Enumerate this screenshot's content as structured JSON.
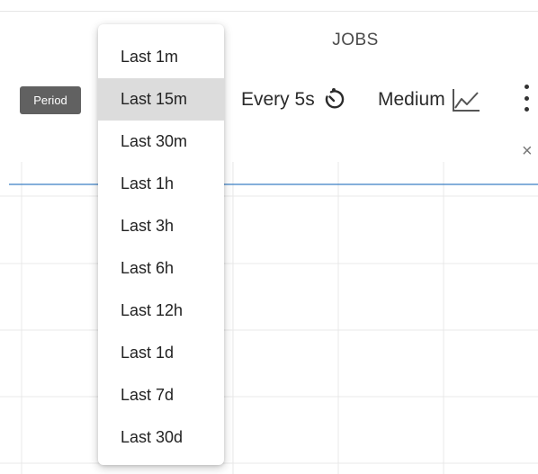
{
  "header": {
    "title": "JOBS"
  },
  "toolbar": {
    "period_label": "Period",
    "refresh_label": "Every 5s",
    "refresh_icon": "timer-icon",
    "resolution_label": "Medium",
    "resolution_icon": "line-chart-icon",
    "more_icon": "kebab-menu-icon",
    "close_icon": "close-icon",
    "close_glyph": "×"
  },
  "period_menu": {
    "selected": "Last 15m",
    "items": [
      {
        "label": "Last 1m"
      },
      {
        "label": "Last 15m"
      },
      {
        "label": "Last 30m"
      },
      {
        "label": "Last 1h"
      },
      {
        "label": "Last 3h"
      },
      {
        "label": "Last 6h"
      },
      {
        "label": "Last 12h"
      },
      {
        "label": "Last 1d"
      },
      {
        "label": "Last 7d"
      },
      {
        "label": "Last 30d"
      }
    ]
  },
  "colors": {
    "series_line": "#3b7fc4",
    "period_tag_bg": "#616161",
    "selected_item_bg": "#dcdcdc",
    "grid": "#e8e8e8"
  }
}
